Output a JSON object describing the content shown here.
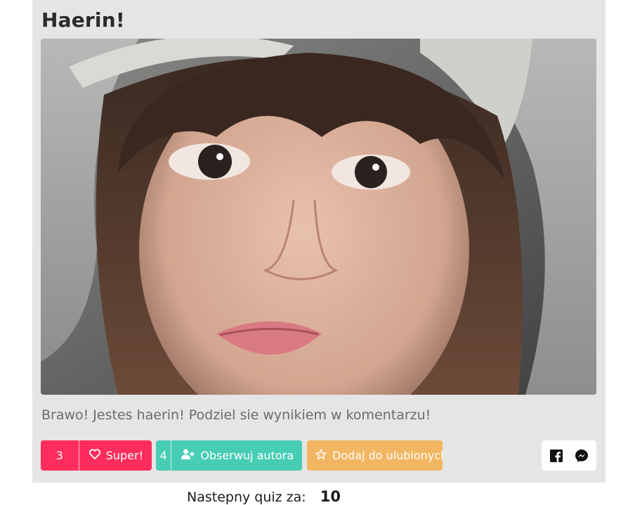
{
  "result": {
    "title": "Haerin!",
    "image_alt": "photo",
    "description": "Brawo! Jestes haerin! Podziel sie wynikiem w komentarzu!"
  },
  "actions": {
    "like": {
      "count": "3",
      "label": "Super!",
      "icon": "heart-icon",
      "color": "#ff2d5d"
    },
    "follow": {
      "count": "4",
      "label": "Obserwuj autora",
      "icon": "user-plus-icon",
      "color": "#48cdb5"
    },
    "favorite": {
      "label": "Dodaj do ulubionych",
      "icon": "star-icon",
      "color": "#f2b662"
    }
  },
  "share": {
    "facebook_icon": "facebook-icon",
    "messenger_icon": "messenger-icon"
  },
  "next_quiz": {
    "label": "Nastepny quiz za:",
    "countdown": "10"
  }
}
